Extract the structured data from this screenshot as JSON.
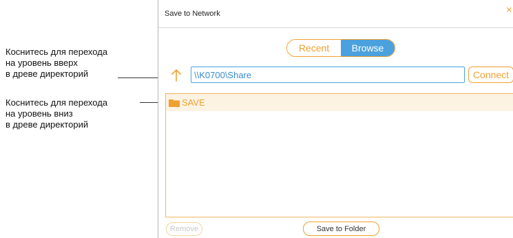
{
  "callouts": {
    "up": "Коснитесь для перехода\nна уровень вверх\nв древе директорий",
    "down": "Коснитесь для перехода\nна уровень вниз\nв древе директорий"
  },
  "dialog": {
    "title": "Save to Network",
    "close_glyph": "×",
    "tabs": {
      "recent": "Recent",
      "browse": "Browse",
      "active": "Browse"
    },
    "path_value": "\\\\K0700\\Share",
    "connect_label": "Connect",
    "folders": [
      "SAVE"
    ],
    "remove_label": "Remove",
    "save_label": "Save to Folder"
  },
  "colors": {
    "accent": "#f0a030",
    "selected_tab": "#4ba1dd",
    "selected_row": "#fdf3e3"
  },
  "icons": [
    "close-icon",
    "up-arrow-icon",
    "folder-icon"
  ]
}
